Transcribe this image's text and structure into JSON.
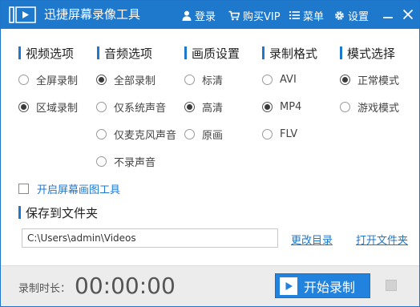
{
  "titlebar": {
    "title": "迅捷屏幕录像工具",
    "login": "登录",
    "vip": "购买VIP",
    "menu": "菜单",
    "settings": "设置"
  },
  "sections": {
    "video": {
      "title": "视频选项",
      "options": [
        {
          "label": "全屏录制",
          "selected": false
        },
        {
          "label": "区域录制",
          "selected": true
        }
      ]
    },
    "audio": {
      "title": "音频选项",
      "options": [
        {
          "label": "全部录制",
          "selected": true
        },
        {
          "label": "仅系统声音",
          "selected": false
        },
        {
          "label": "仅麦克风声音",
          "selected": false
        },
        {
          "label": "不录声音",
          "selected": false
        }
      ]
    },
    "quality": {
      "title": "画质设置",
      "options": [
        {
          "label": "标清",
          "selected": false
        },
        {
          "label": "高清",
          "selected": true
        },
        {
          "label": "原画",
          "selected": false
        }
      ]
    },
    "format": {
      "title": "录制格式",
      "options": [
        {
          "label": "AVI",
          "selected": false
        },
        {
          "label": "MP4",
          "selected": true
        },
        {
          "label": "FLV",
          "selected": false
        }
      ]
    },
    "mode": {
      "title": "模式选择",
      "options": [
        {
          "label": "正常模式",
          "selected": true
        },
        {
          "label": "游戏模式",
          "selected": false
        }
      ]
    }
  },
  "draw_tool": {
    "label": "开启屏幕画图工具",
    "checked": false
  },
  "save": {
    "title": "保存到文件夹",
    "path": "C:\\Users\\admin\\Videos",
    "change_dir": "更改目录",
    "open_folder": "打开文件夹"
  },
  "bottom": {
    "duration_label": "录制时长：",
    "duration_value": "00:00:00",
    "start_label": "开始录制"
  },
  "colors": {
    "accent": "#1e78cc",
    "button": "#2183dd",
    "bottom_bg": "#ececec"
  }
}
